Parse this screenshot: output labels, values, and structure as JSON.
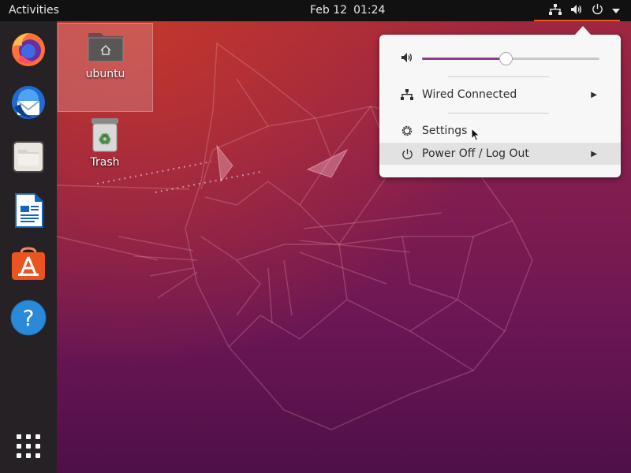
{
  "topbar": {
    "activities": "Activities",
    "date": "Feb 12",
    "time": "01:24"
  },
  "tray": {
    "network_icon": "network-wired-icon",
    "volume_icon": "speaker-icon",
    "power_icon": "power-icon",
    "menu_icon": "chevron-down-icon",
    "accent": "#e95420"
  },
  "dock": {
    "items": [
      {
        "name": "Firefox",
        "icon": "firefox-icon"
      },
      {
        "name": "Thunderbird",
        "icon": "thunderbird-icon"
      },
      {
        "name": "Files",
        "icon": "files-icon"
      },
      {
        "name": "LibreOffice Writer",
        "icon": "writer-icon"
      },
      {
        "name": "Ubuntu Software",
        "icon": "software-icon"
      },
      {
        "name": "Help",
        "icon": "help-icon"
      }
    ],
    "apps_grid_icon": "show-applications-icon"
  },
  "desktop": {
    "icons": [
      {
        "label": "ubuntu",
        "icon": "home-folder-icon",
        "selected": true
      },
      {
        "label": "Trash",
        "icon": "trash-icon",
        "selected": false
      }
    ]
  },
  "menu": {
    "volume": {
      "level": 0.47,
      "accent": "#8c3b8f"
    },
    "wired": {
      "label": "Wired Connected"
    },
    "settings": {
      "label": "Settings"
    },
    "power": {
      "label": "Power Off / Log Out"
    }
  }
}
